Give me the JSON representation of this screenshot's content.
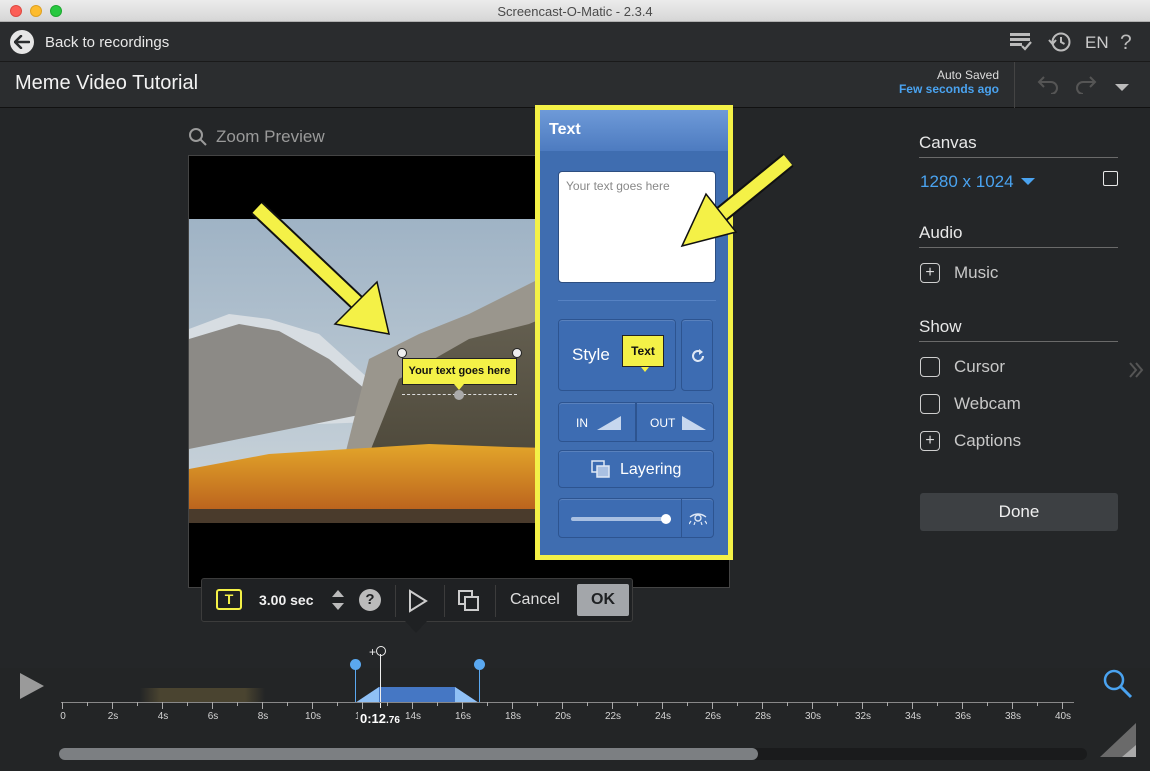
{
  "window": {
    "title": "Screencast-O-Matic - 2.3.4"
  },
  "nav": {
    "back_label": "Back to recordings",
    "language": "EN"
  },
  "header": {
    "project_title": "Meme Video Tutorial",
    "autosave_label": "Auto Saved",
    "autosave_time": "Few seconds ago"
  },
  "preview": {
    "zoom_label": "Zoom Preview",
    "caption_text": "Your text goes here"
  },
  "text_panel": {
    "title": "Text",
    "placeholder": "Your text goes here",
    "style_label": "Style",
    "style_sample": "Text",
    "in_label": "IN",
    "out_label": "OUT",
    "layering_label": "Layering",
    "opacity": 0.97
  },
  "right_panel": {
    "canvas_heading": "Canvas",
    "canvas_size": "1280 x 1024",
    "audio_heading": "Audio",
    "music_label": "Music",
    "show_heading": "Show",
    "cursor_label": "Cursor",
    "webcam_label": "Webcam",
    "captions_label": "Captions",
    "done_label": "Done"
  },
  "toolbar": {
    "duration": "3.00 sec",
    "cancel_label": "Cancel",
    "ok_label": "OK"
  },
  "timeline": {
    "current_time_main": "0:12",
    "current_time_frac": ".76",
    "ticks": [
      "0",
      "2s",
      "4s",
      "6s",
      "8s",
      "10s",
      "12s",
      "14s",
      "16s",
      "18s",
      "20s",
      "22s",
      "24s",
      "26s",
      "28s",
      "30s",
      "32s",
      "34s",
      "36s",
      "38s",
      "40s"
    ],
    "selection_start": 11.7,
    "selection_end": 16.7,
    "playhead": 12.76,
    "scroll_fraction": 0.68
  },
  "colors": {
    "accent": "#4aa3f0",
    "highlight": "#f4f147",
    "panel_blue": "#3f6db0"
  }
}
